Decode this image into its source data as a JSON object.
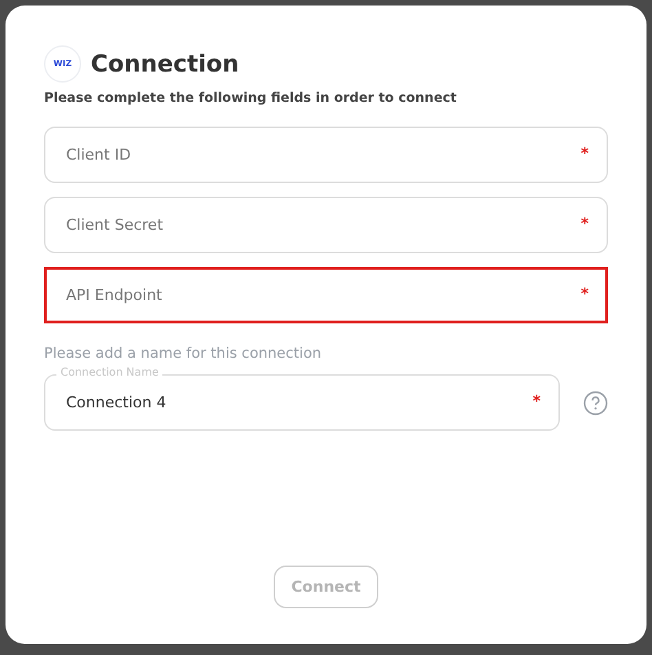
{
  "dialog": {
    "logo": "WIZ",
    "title": "Connection",
    "subtitle": "Please complete the following fields in order to connect"
  },
  "fields": [
    {
      "placeholder": "Client ID",
      "required": "*",
      "highlighted": false
    },
    {
      "placeholder": "Client Secret",
      "required": "*",
      "highlighted": false
    },
    {
      "placeholder": "API Endpoint",
      "required": "*",
      "highlighted": true
    }
  ],
  "name_section": {
    "hint": "Please add a name for this connection",
    "label": "Connection Name",
    "value": "Connection 4",
    "required": "*"
  },
  "connect_button": {
    "label": "Connect",
    "disabled": true
  }
}
